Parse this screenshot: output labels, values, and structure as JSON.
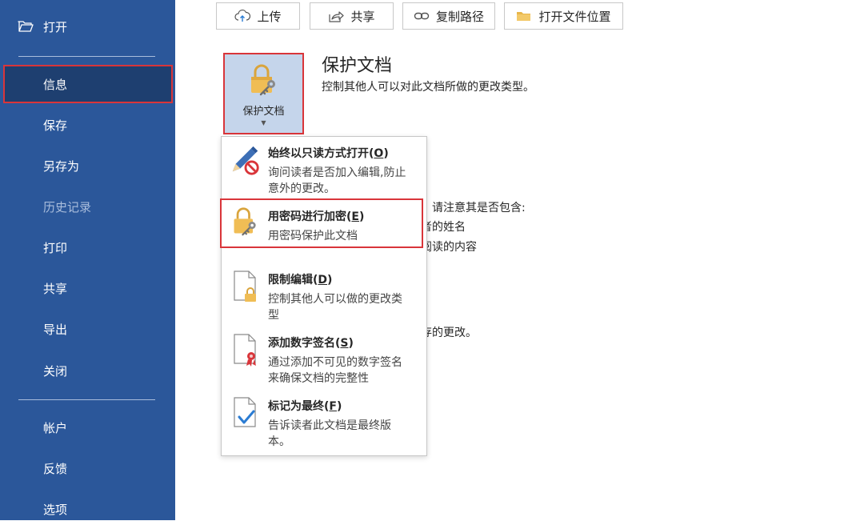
{
  "nav": {
    "open": "打开",
    "info": "信息",
    "save": "保存",
    "save_as": "另存为",
    "history": "历史记录",
    "print": "打印",
    "share": "共享",
    "export": "导出",
    "close": "关闭",
    "account": "帐户",
    "feedback": "反馈",
    "options": "选项"
  },
  "toolbar": {
    "upload": "上传",
    "share": "共享",
    "copy_path": "复制路径",
    "open_location": "打开文件位置"
  },
  "protect": {
    "tile_label": "保护文档",
    "title": "保护文档",
    "description": "控制其他人可以对此文档所做的更改类型。"
  },
  "background": {
    "line1": "请注意其是否包含:",
    "line2": "者的姓名",
    "line3": "阅读的内容",
    "line4": "存的更改。"
  },
  "menu": {
    "items": [
      {
        "title": "始终以只读方式打开(",
        "key": "O",
        "close": ")",
        "desc": "询问读者是否加入编辑,防止意外的更改。"
      },
      {
        "title": "用密码进行加密(",
        "key": "E",
        "close": ")",
        "desc": "用密码保护此文档"
      },
      {
        "title": "限制编辑(",
        "key": "D",
        "close": ")",
        "desc": "控制其他人可以做的更改类型"
      },
      {
        "title": "添加数字签名(",
        "key": "S",
        "close": ")",
        "desc": "通过添加不可见的数字签名来确保文档的完整性"
      },
      {
        "title": "标记为最终(",
        "key": "F",
        "close": ")",
        "desc": "告诉读者此文档是最终版本。"
      }
    ]
  },
  "colors": {
    "nav_bg": "#2b579a",
    "nav_selected": "#1e3f70",
    "highlight_red": "#d9353a",
    "tile_bg": "#c5d5eb"
  }
}
